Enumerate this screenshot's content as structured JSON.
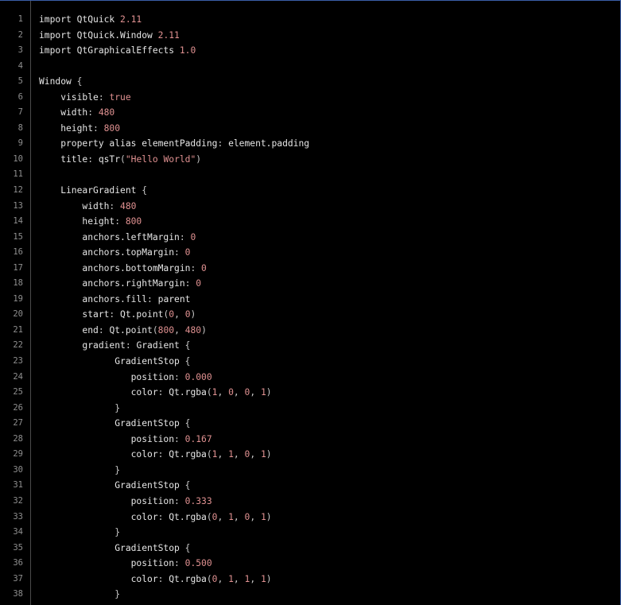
{
  "colors": {
    "background": "#000000",
    "plain": "#e6e6e6",
    "literal": "#e09191",
    "line_number": "#8f8f8f",
    "gutter_border": "#4a4a4a",
    "frame": "#3a5ea8"
  },
  "lines": [
    {
      "n": "1",
      "tokens": [
        {
          "t": "import QtQuick ",
          "k": "plain"
        },
        {
          "t": "2.11",
          "k": "num"
        }
      ]
    },
    {
      "n": "2",
      "tokens": [
        {
          "t": "import QtQuick.Window ",
          "k": "plain"
        },
        {
          "t": "2.11",
          "k": "num"
        }
      ]
    },
    {
      "n": "3",
      "tokens": [
        {
          "t": "import QtGraphicalEffects ",
          "k": "plain"
        },
        {
          "t": "1.0",
          "k": "num"
        }
      ]
    },
    {
      "n": "4",
      "tokens": []
    },
    {
      "n": "5",
      "tokens": [
        {
          "t": "Window ",
          "k": "plain"
        },
        {
          "t": "{",
          "k": "punct"
        }
      ]
    },
    {
      "n": "6",
      "tokens": [
        {
          "t": "    visible",
          "k": "plain"
        },
        {
          "t": ": ",
          "k": "punct"
        },
        {
          "t": "true",
          "k": "kw"
        }
      ]
    },
    {
      "n": "7",
      "tokens": [
        {
          "t": "    width",
          "k": "plain"
        },
        {
          "t": ": ",
          "k": "punct"
        },
        {
          "t": "480",
          "k": "num"
        }
      ]
    },
    {
      "n": "8",
      "tokens": [
        {
          "t": "    height",
          "k": "plain"
        },
        {
          "t": ": ",
          "k": "punct"
        },
        {
          "t": "800",
          "k": "num"
        }
      ]
    },
    {
      "n": "9",
      "tokens": [
        {
          "t": "    property alias elementPadding",
          "k": "plain"
        },
        {
          "t": ": ",
          "k": "punct"
        },
        {
          "t": "element.padding",
          "k": "plain"
        }
      ]
    },
    {
      "n": "10",
      "tokens": [
        {
          "t": "    title",
          "k": "plain"
        },
        {
          "t": ": ",
          "k": "punct"
        },
        {
          "t": "qsTr",
          "k": "plain"
        },
        {
          "t": "(",
          "k": "punct"
        },
        {
          "t": "\"Hello World\"",
          "k": "str"
        },
        {
          "t": ")",
          "k": "punct"
        }
      ]
    },
    {
      "n": "11",
      "tokens": []
    },
    {
      "n": "12",
      "tokens": [
        {
          "t": "    LinearGradient ",
          "k": "plain"
        },
        {
          "t": "{",
          "k": "punct"
        }
      ]
    },
    {
      "n": "13",
      "tokens": [
        {
          "t": "        width",
          "k": "plain"
        },
        {
          "t": ": ",
          "k": "punct"
        },
        {
          "t": "480",
          "k": "num"
        }
      ]
    },
    {
      "n": "14",
      "tokens": [
        {
          "t": "        height",
          "k": "plain"
        },
        {
          "t": ": ",
          "k": "punct"
        },
        {
          "t": "800",
          "k": "num"
        }
      ]
    },
    {
      "n": "15",
      "tokens": [
        {
          "t": "        anchors.leftMargin",
          "k": "plain"
        },
        {
          "t": ": ",
          "k": "punct"
        },
        {
          "t": "0",
          "k": "num"
        }
      ]
    },
    {
      "n": "16",
      "tokens": [
        {
          "t": "        anchors.topMargin",
          "k": "plain"
        },
        {
          "t": ": ",
          "k": "punct"
        },
        {
          "t": "0",
          "k": "num"
        }
      ]
    },
    {
      "n": "17",
      "tokens": [
        {
          "t": "        anchors.bottomMargin",
          "k": "plain"
        },
        {
          "t": ": ",
          "k": "punct"
        },
        {
          "t": "0",
          "k": "num"
        }
      ]
    },
    {
      "n": "18",
      "tokens": [
        {
          "t": "        anchors.rightMargin",
          "k": "plain"
        },
        {
          "t": ": ",
          "k": "punct"
        },
        {
          "t": "0",
          "k": "num"
        }
      ]
    },
    {
      "n": "19",
      "tokens": [
        {
          "t": "        anchors.fill",
          "k": "plain"
        },
        {
          "t": ": ",
          "k": "punct"
        },
        {
          "t": "parent",
          "k": "plain"
        }
      ]
    },
    {
      "n": "20",
      "tokens": [
        {
          "t": "        start",
          "k": "plain"
        },
        {
          "t": ": ",
          "k": "punct"
        },
        {
          "t": "Qt.point",
          "k": "plain"
        },
        {
          "t": "(",
          "k": "punct"
        },
        {
          "t": "0",
          "k": "num"
        },
        {
          "t": ", ",
          "k": "punct"
        },
        {
          "t": "0",
          "k": "num"
        },
        {
          "t": ")",
          "k": "punct"
        }
      ]
    },
    {
      "n": "21",
      "tokens": [
        {
          "t": "        end",
          "k": "plain"
        },
        {
          "t": ": ",
          "k": "punct"
        },
        {
          "t": "Qt.point",
          "k": "plain"
        },
        {
          "t": "(",
          "k": "punct"
        },
        {
          "t": "800",
          "k": "num"
        },
        {
          "t": ", ",
          "k": "punct"
        },
        {
          "t": "480",
          "k": "num"
        },
        {
          "t": ")",
          "k": "punct"
        }
      ]
    },
    {
      "n": "22",
      "tokens": [
        {
          "t": "        gradient",
          "k": "plain"
        },
        {
          "t": ": ",
          "k": "punct"
        },
        {
          "t": "Gradient ",
          "k": "plain"
        },
        {
          "t": "{",
          "k": "punct"
        }
      ]
    },
    {
      "n": "23",
      "tokens": [
        {
          "t": "              GradientStop ",
          "k": "plain"
        },
        {
          "t": "{",
          "k": "punct"
        }
      ]
    },
    {
      "n": "24",
      "tokens": [
        {
          "t": "                 position",
          "k": "plain"
        },
        {
          "t": ": ",
          "k": "punct"
        },
        {
          "t": "0.000",
          "k": "num"
        }
      ]
    },
    {
      "n": "25",
      "tokens": [
        {
          "t": "                 color",
          "k": "plain"
        },
        {
          "t": ": ",
          "k": "punct"
        },
        {
          "t": "Qt.rgba",
          "k": "plain"
        },
        {
          "t": "(",
          "k": "punct"
        },
        {
          "t": "1",
          "k": "num"
        },
        {
          "t": ", ",
          "k": "punct"
        },
        {
          "t": "0",
          "k": "num"
        },
        {
          "t": ", ",
          "k": "punct"
        },
        {
          "t": "0",
          "k": "num"
        },
        {
          "t": ", ",
          "k": "punct"
        },
        {
          "t": "1",
          "k": "num"
        },
        {
          "t": ")",
          "k": "punct"
        }
      ]
    },
    {
      "n": "26",
      "tokens": [
        {
          "t": "              ",
          "k": "plain"
        },
        {
          "t": "}",
          "k": "punct"
        }
      ]
    },
    {
      "n": "27",
      "tokens": [
        {
          "t": "              GradientStop ",
          "k": "plain"
        },
        {
          "t": "{",
          "k": "punct"
        }
      ]
    },
    {
      "n": "28",
      "tokens": [
        {
          "t": "                 position",
          "k": "plain"
        },
        {
          "t": ": ",
          "k": "punct"
        },
        {
          "t": "0.167",
          "k": "num"
        }
      ]
    },
    {
      "n": "29",
      "tokens": [
        {
          "t": "                 color",
          "k": "plain"
        },
        {
          "t": ": ",
          "k": "punct"
        },
        {
          "t": "Qt.rgba",
          "k": "plain"
        },
        {
          "t": "(",
          "k": "punct"
        },
        {
          "t": "1",
          "k": "num"
        },
        {
          "t": ", ",
          "k": "punct"
        },
        {
          "t": "1",
          "k": "num"
        },
        {
          "t": ", ",
          "k": "punct"
        },
        {
          "t": "0",
          "k": "num"
        },
        {
          "t": ", ",
          "k": "punct"
        },
        {
          "t": "1",
          "k": "num"
        },
        {
          "t": ")",
          "k": "punct"
        }
      ]
    },
    {
      "n": "30",
      "tokens": [
        {
          "t": "              ",
          "k": "plain"
        },
        {
          "t": "}",
          "k": "punct"
        }
      ]
    },
    {
      "n": "31",
      "tokens": [
        {
          "t": "              GradientStop ",
          "k": "plain"
        },
        {
          "t": "{",
          "k": "punct"
        }
      ]
    },
    {
      "n": "32",
      "tokens": [
        {
          "t": "                 position",
          "k": "plain"
        },
        {
          "t": ": ",
          "k": "punct"
        },
        {
          "t": "0.333",
          "k": "num"
        }
      ]
    },
    {
      "n": "33",
      "tokens": [
        {
          "t": "                 color",
          "k": "plain"
        },
        {
          "t": ": ",
          "k": "punct"
        },
        {
          "t": "Qt.rgba",
          "k": "plain"
        },
        {
          "t": "(",
          "k": "punct"
        },
        {
          "t": "0",
          "k": "num"
        },
        {
          "t": ", ",
          "k": "punct"
        },
        {
          "t": "1",
          "k": "num"
        },
        {
          "t": ", ",
          "k": "punct"
        },
        {
          "t": "0",
          "k": "num"
        },
        {
          "t": ", ",
          "k": "punct"
        },
        {
          "t": "1",
          "k": "num"
        },
        {
          "t": ")",
          "k": "punct"
        }
      ]
    },
    {
      "n": "34",
      "tokens": [
        {
          "t": "              ",
          "k": "plain"
        },
        {
          "t": "}",
          "k": "punct"
        }
      ]
    },
    {
      "n": "35",
      "tokens": [
        {
          "t": "              GradientStop ",
          "k": "plain"
        },
        {
          "t": "{",
          "k": "punct"
        }
      ]
    },
    {
      "n": "36",
      "tokens": [
        {
          "t": "                 position",
          "k": "plain"
        },
        {
          "t": ": ",
          "k": "punct"
        },
        {
          "t": "0.500",
          "k": "num"
        }
      ]
    },
    {
      "n": "37",
      "tokens": [
        {
          "t": "                 color",
          "k": "plain"
        },
        {
          "t": ": ",
          "k": "punct"
        },
        {
          "t": "Qt.rgba",
          "k": "plain"
        },
        {
          "t": "(",
          "k": "punct"
        },
        {
          "t": "0",
          "k": "num"
        },
        {
          "t": ", ",
          "k": "punct"
        },
        {
          "t": "1",
          "k": "num"
        },
        {
          "t": ", ",
          "k": "punct"
        },
        {
          "t": "1",
          "k": "num"
        },
        {
          "t": ", ",
          "k": "punct"
        },
        {
          "t": "1",
          "k": "num"
        },
        {
          "t": ")",
          "k": "punct"
        }
      ]
    },
    {
      "n": "38",
      "tokens": [
        {
          "t": "              ",
          "k": "plain"
        },
        {
          "t": "}",
          "k": "punct"
        }
      ]
    }
  ]
}
